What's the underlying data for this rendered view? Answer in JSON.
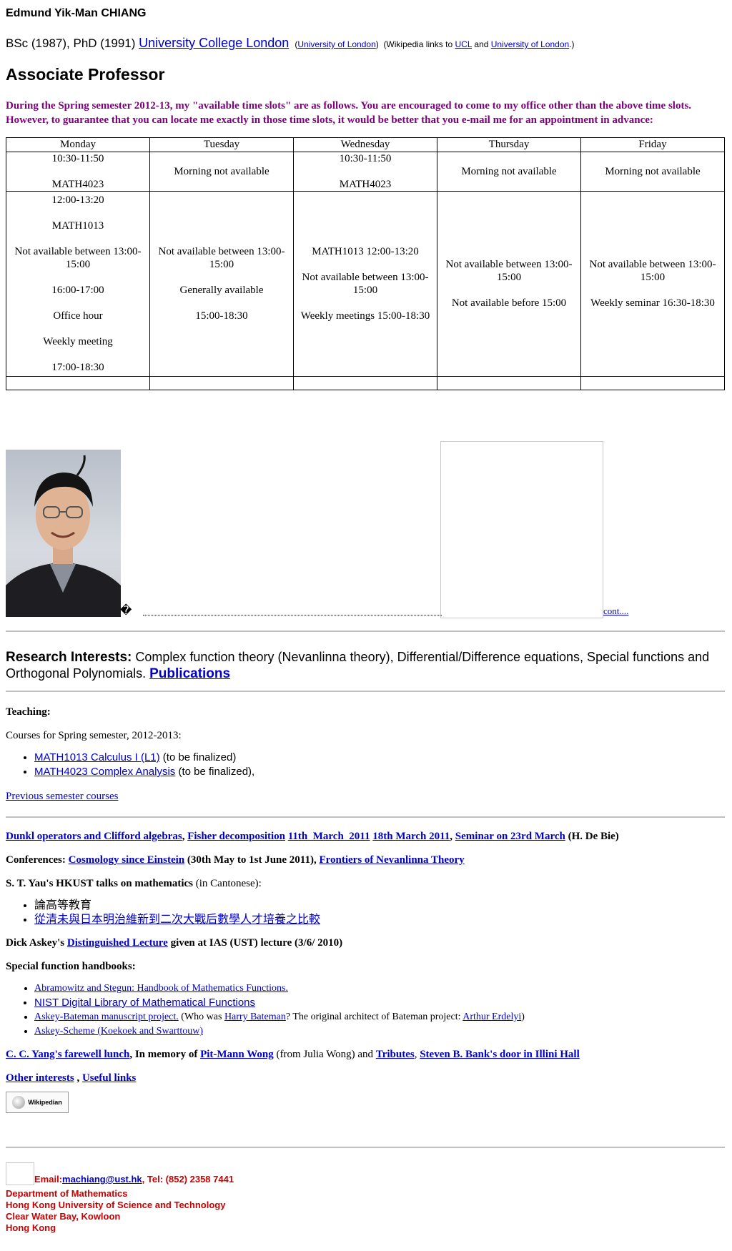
{
  "header": {
    "name": "Edmund Yik-Man CHIANG",
    "degrees_prefix": "BSc (1987), PhD (1991)",
    "ucl_link": "University College London",
    "uol_paren_link": "University of London",
    "wiki_note_prefix": "(Wikipedia links to",
    "wiki_ucl": "UCL",
    "wiki_and": "and",
    "wiki_uol": "University of London",
    "wiki_note_suffix": ".)",
    "position": "Associate Professor"
  },
  "notice": "During the Spring semester 2012-13, my \"available time slots\" are as follows. You are encouraged to come to my office other than the above time slots. However, to guarantee that you can locate me exactly in those time slots, it would be better that you e-mail me for an appointment in advance:",
  "schedule": {
    "days": [
      "Monday",
      "Tuesday",
      "Wednesday",
      "Thursday",
      "Friday"
    ],
    "row1": [
      [
        "10:30-11:50",
        "MATH4023"
      ],
      [
        "Morning not available"
      ],
      [
        "10:30-11:50",
        "MATH4023"
      ],
      [
        "Morning not available"
      ],
      [
        "Morning not available"
      ]
    ],
    "row2": [
      [
        "12:00-13:20",
        "MATH1013",
        "Not available between 13:00-15:00",
        "16:00-17:00",
        "Office hour",
        "Weekly meeting",
        "17:00-18:30"
      ],
      [
        "Not available between 13:00-15:00",
        "Generally available",
        "15:00-18:30"
      ],
      [
        "MATH1013 12:00-13:20",
        "Not available between 13:00-15:00",
        "Weekly meetings 15:00-18:30"
      ],
      [
        "Not available between 13:00-15:00",
        "Not available before 15:00"
      ],
      [
        "Not available between 13:00-15:00",
        "Weekly seminar 16:30-18:30"
      ]
    ]
  },
  "photo_row": {
    "glyph": "�",
    "cont_link": "cont...."
  },
  "research": {
    "heading": "Research Interests:",
    "text": "Complex function theory (Nevanlinna theory), Differential/Difference equations, Special functions and Orthogonal Polynomials.",
    "publications_link": "Publications"
  },
  "teaching": {
    "heading": "Teaching:",
    "courses_intro": "Courses for Spring semester, 2012-2013:",
    "courses": [
      {
        "link": "MATH1013 Calculus I (L1)",
        "note": "(to be finalized)"
      },
      {
        "link": "MATH4023 Complex Analysis",
        "note": "(to be finalized),"
      }
    ],
    "previous_link": "Previous semester courses"
  },
  "misc": {
    "dunkl": "Dunkl operators and Clifford algebras",
    "fisher": "Fisher decomposition",
    "march11": "11th_March_2011",
    "march18": "18th March 2011",
    "seminar": "Seminar on  23rd March",
    "debie": "(H. De Bie)",
    "conf_label": "Conferences:",
    "cosmology": "Cosmology since Einstein",
    "cosmology_dates": "(30th May to 1st June 2011),",
    "frontiers": "Frontiers of Nevanlinna Theory",
    "yau_bold": "S. T. Yau's HKUST talks on mathematics",
    "yau_lang": "(in Cantonese):",
    "yau_talk1": "論高等教育",
    "yau_talk2": "從清未與日本明治維新到二次大戰后數學人才培養之比較",
    "askey_prefix": "Dick Askey's",
    "askey_link": "Distinguished Lecture",
    "askey_suffix": "given at IAS (UST) lecture (3/6/ 2010)",
    "handbooks_heading": "Special function handbooks:",
    "hb1": "Abramowitz and Stegun: Handbook of Mathematics Functions.",
    "hb2": "NIST Digital Library of Mathematical Functions",
    "hb3": "Askey-Bateman manuscript project.",
    "hb3_who": "(Who was",
    "hb3_bateman": "Harry Bateman",
    "hb3_mid": "?   The original architect of Bateman project:",
    "hb3_erdelyi": "Arthur Erdelyi",
    "hb3_end": ")",
    "hb4": "Askey-Scheme (Koekoek and Swarttouw)",
    "yang": "C. C. Yang's farewell lunch",
    "memory": ", In memory of",
    "wong": "Pit-Mann Wong",
    "from_julia": "(from Julia Wong) and",
    "tributes": "Tributes",
    "bank": "Steven B. Bank's door in Illini Hall",
    "other": "Other interests",
    "useful": "Useful links",
    "wikipedian": "Wikipedian"
  },
  "contact": {
    "email_label": "Email:",
    "email": "machiang@ust.hk",
    "tel": ", Tel: (852) 2358 7441",
    "dept": "Department of Mathematics",
    "univ": "Hong Kong University of Science and Technology",
    "addr1": "Clear Water Bay, Kowloon",
    "addr2": "Hong Kong"
  }
}
